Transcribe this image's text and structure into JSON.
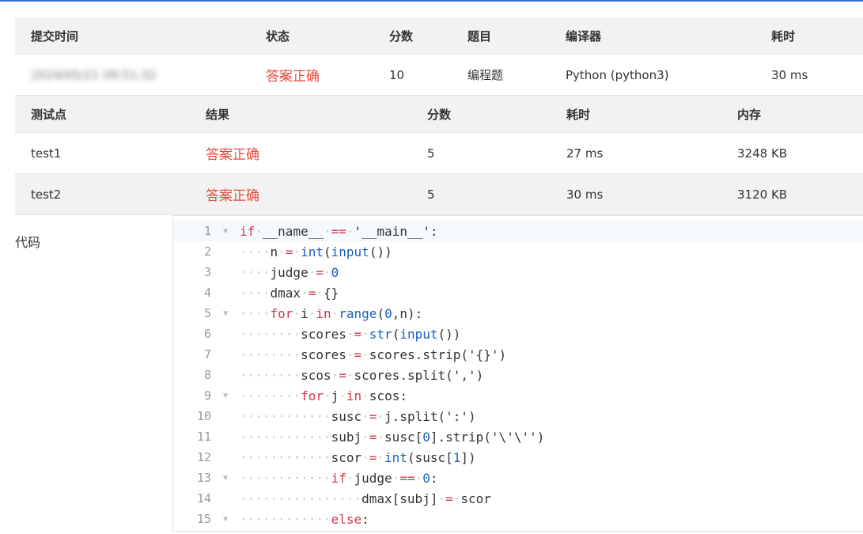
{
  "submission": {
    "headers": [
      "提交时间",
      "状态",
      "分数",
      "题目",
      "编译器",
      "耗时"
    ],
    "row": {
      "time": "2024/05/21 09:51:32",
      "status": "答案正确",
      "score": "10",
      "problem": "编程题",
      "compiler": "Python (python3)",
      "elapsed": "30 ms"
    }
  },
  "tests": {
    "headers": [
      "测试点",
      "结果",
      "分数",
      "耗时",
      "内存"
    ],
    "rows": [
      {
        "name": "test1",
        "result": "答案正确",
        "score": "5",
        "elapsed": "27 ms",
        "memory": "3248 KB"
      },
      {
        "name": "test2",
        "result": "答案正确",
        "score": "5",
        "elapsed": "30 ms",
        "memory": "3120 KB"
      }
    ]
  },
  "code": {
    "label": "代码",
    "lines": [
      {
        "n": "1",
        "fold": true,
        "text": "if __name__ == '__main__':"
      },
      {
        "n": "2",
        "fold": false,
        "text": "    n = int(input())"
      },
      {
        "n": "3",
        "fold": false,
        "text": "    judge = 0"
      },
      {
        "n": "4",
        "fold": false,
        "text": "    dmax = {}"
      },
      {
        "n": "5",
        "fold": true,
        "text": "    for i in range(0,n):"
      },
      {
        "n": "6",
        "fold": false,
        "text": "        scores = str(input())"
      },
      {
        "n": "7",
        "fold": false,
        "text": "        scores = scores.strip('{}')"
      },
      {
        "n": "8",
        "fold": false,
        "text": "        scos = scores.split(',')"
      },
      {
        "n": "9",
        "fold": true,
        "text": "        for j in scos:"
      },
      {
        "n": "10",
        "fold": false,
        "text": "            susc = j.split(':')"
      },
      {
        "n": "11",
        "fold": false,
        "text": "            subj = susc[0].strip('\\'\\'')"
      },
      {
        "n": "12",
        "fold": false,
        "text": "            scor = int(susc[1])"
      },
      {
        "n": "13",
        "fold": true,
        "text": "            if judge == 0:"
      },
      {
        "n": "14",
        "fold": false,
        "text": "                dmax[subj] = scor"
      },
      {
        "n": "15",
        "fold": true,
        "text": "            else:"
      }
    ]
  }
}
